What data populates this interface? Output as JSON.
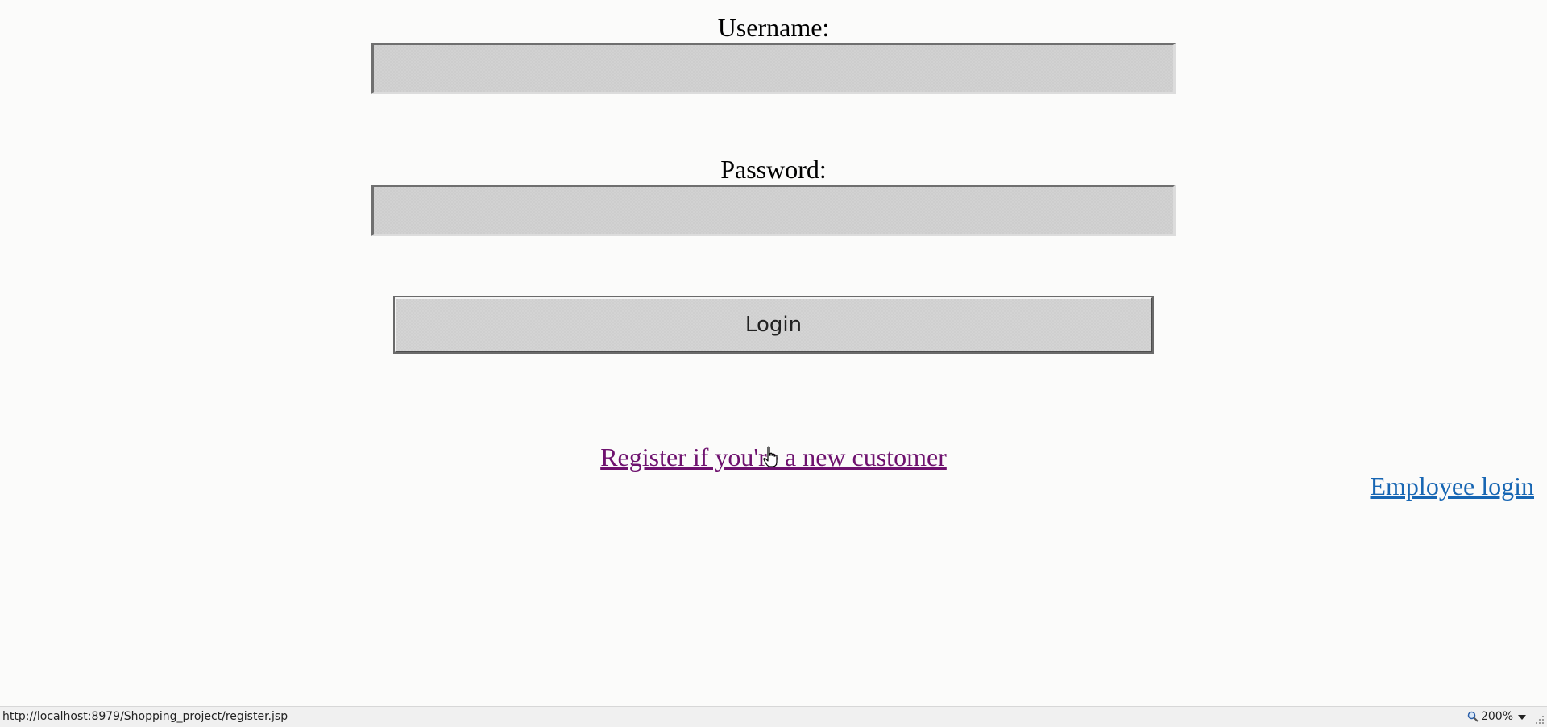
{
  "form": {
    "username_label": "Username:",
    "username_value": "",
    "password_label": "Password:",
    "password_value": "",
    "login_button": "Login"
  },
  "links": {
    "register": "Register if you're a new customer",
    "employee_login": "Employee login"
  },
  "status_bar": {
    "url": "http://localhost:8979/Shopping_project/register.jsp",
    "zoom": "200%"
  },
  "colors": {
    "page_bg": "#fbfbfa",
    "visited_link": "#6e116e",
    "link": "#1766b3",
    "field_bg": "#cdcdcd"
  },
  "icons": {
    "zoom": "magnifier-icon",
    "cursor": "hand-pointer-icon"
  }
}
